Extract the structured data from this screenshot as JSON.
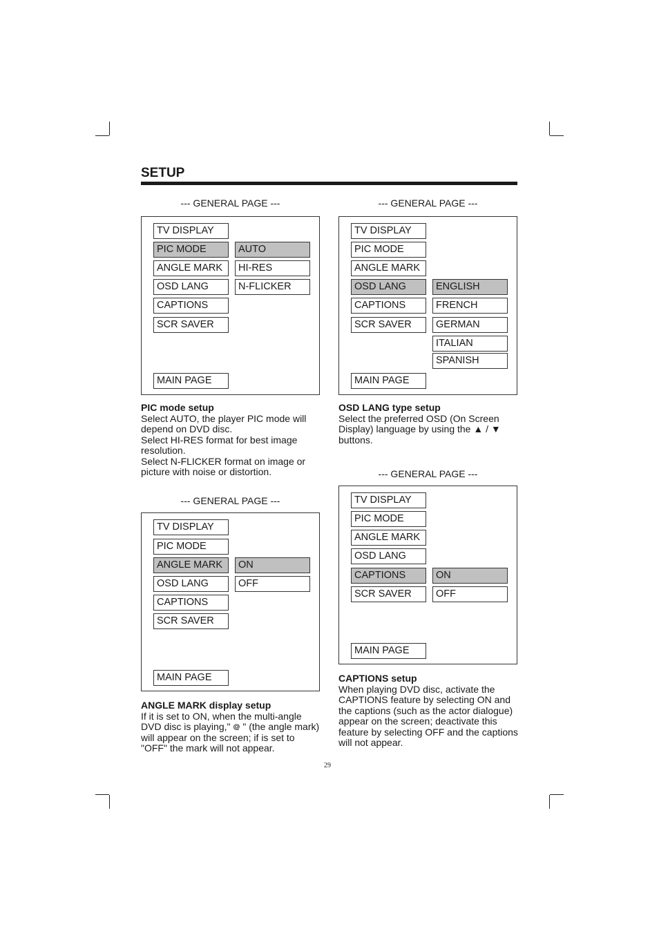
{
  "page_title": "SETUP",
  "page_number": "29",
  "panels": [
    {
      "header": "--- GENERAL PAGE ---",
      "menu": [
        "TV DISPLAY",
        "PIC MODE",
        "ANGLE MARK",
        "OSD LANG",
        "CAPTIONS",
        "SCR SAVER"
      ],
      "selected_menu": "PIC MODE",
      "options": [
        "AUTO",
        "HI-RES",
        "N-FLICKER"
      ],
      "selected_option": "AUTO",
      "main_page": "MAIN PAGE"
    },
    {
      "header": "--- GENERAL PAGE ---",
      "menu": [
        "TV DISPLAY",
        "PIC MODE",
        "ANGLE MARK",
        "OSD LANG",
        "CAPTIONS",
        "SCR SAVER"
      ],
      "selected_menu": "OSD LANG",
      "options": [
        "ENGLISH",
        "FRENCH",
        "GERMAN",
        "ITALIAN",
        "SPANISH"
      ],
      "selected_option": "ENGLISH",
      "main_page": "MAIN PAGE"
    },
    {
      "header": "--- GENERAL PAGE ---",
      "menu": [
        "TV DISPLAY",
        "PIC MODE",
        "ANGLE MARK",
        "OSD LANG",
        "CAPTIONS",
        "SCR SAVER"
      ],
      "selected_menu": "ANGLE MARK",
      "options": [
        "ON",
        "OFF"
      ],
      "selected_option": "ON",
      "main_page": "MAIN PAGE"
    },
    {
      "header": "--- GENERAL PAGE ---",
      "menu": [
        "TV DISPLAY",
        "PIC MODE",
        "ANGLE MARK",
        "OSD LANG",
        "CAPTIONS",
        "SCR SAVER"
      ],
      "selected_menu": "CAPTIONS",
      "options": [
        "ON",
        "OFF"
      ],
      "selected_option": "ON",
      "main_page": "MAIN PAGE"
    }
  ],
  "descriptions": {
    "pic_mode": {
      "heading": "PIC mode setup",
      "lines": [
        "Select AUTO, the player PIC mode will",
        "depend on DVD disc.",
        "Select HI-RES format for best image",
        "resolution.",
        "Select N-FLICKER format on image or",
        "picture with noise or distortion."
      ]
    },
    "osd_lang": {
      "heading": "OSD LANG type setup",
      "lines": [
        "Select the preferred OSD (On Screen",
        "Display) language by using the ▲ / ▼",
        "buttons."
      ]
    },
    "angle_mark": {
      "heading": "ANGLE MARK display setup",
      "lines": [
        "If it is set to ON, when the multi-angle",
        "DVD disc is playing,\" ᪤ \" (the angle mark)",
        "will appear on the screen; if is set to",
        "\"OFF\" the mark will not appear."
      ]
    },
    "captions": {
      "heading": "CAPTIONS setup",
      "lines": [
        "When playing DVD disc, activate the",
        "CAPTIONS feature by selecting ON and",
        "the captions (such as the actor dialogue)",
        "appear on the screen; deactivate this",
        "feature by selecting OFF and the captions",
        "will not appear."
      ]
    }
  },
  "colors": {
    "highlight": "#c0c0c0",
    "text": "#1a1a1a"
  }
}
